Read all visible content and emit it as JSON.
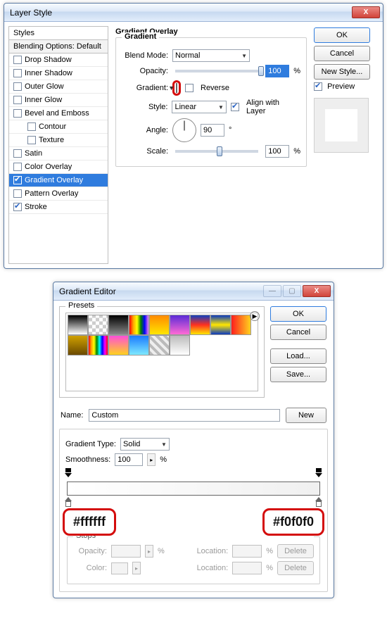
{
  "layerStyle": {
    "title": "Layer Style",
    "stylesHeader": "Styles",
    "blendingOptions": "Blending Options: Default",
    "effects": [
      {
        "label": "Drop Shadow",
        "checked": false,
        "selected": false
      },
      {
        "label": "Inner Shadow",
        "checked": false,
        "selected": false
      },
      {
        "label": "Outer Glow",
        "checked": false,
        "selected": false
      },
      {
        "label": "Inner Glow",
        "checked": false,
        "selected": false
      },
      {
        "label": "Bevel and Emboss",
        "checked": false,
        "selected": false
      },
      {
        "label": "Contour",
        "checked": false,
        "selected": false,
        "indent": true
      },
      {
        "label": "Texture",
        "checked": false,
        "selected": false,
        "indent": true
      },
      {
        "label": "Satin",
        "checked": false,
        "selected": false
      },
      {
        "label": "Color Overlay",
        "checked": false,
        "selected": false
      },
      {
        "label": "Gradient Overlay",
        "checked": true,
        "selected": true
      },
      {
        "label": "Pattern Overlay",
        "checked": false,
        "selected": false
      },
      {
        "label": "Stroke",
        "checked": true,
        "selected": false
      }
    ],
    "panelTitle": "Gradient Overlay",
    "groupTitle": "Gradient",
    "labels": {
      "blendMode": "Blend Mode:",
      "opacity": "Opacity:",
      "gradient": "Gradient:",
      "reverse": "Reverse",
      "style": "Style:",
      "alignWith": "Align with Layer",
      "angle": "Angle:",
      "scale": "Scale:"
    },
    "values": {
      "blendMode": "Normal",
      "opacity": "100",
      "opacityUnit": "%",
      "reverseChecked": false,
      "style": "Linear",
      "alignChecked": true,
      "angle": "90",
      "angleUnit": "°",
      "scale": "100",
      "scaleUnit": "%"
    },
    "buttons": {
      "ok": "OK",
      "cancel": "Cancel",
      "newStyle": "New Style...",
      "previewLabel": "Preview",
      "previewChecked": true
    }
  },
  "gradEditor": {
    "title": "Gradient Editor",
    "presetsLabel": "Presets",
    "buttons": {
      "ok": "OK",
      "cancel": "Cancel",
      "load": "Load...",
      "save": "Save...",
      "new": "New",
      "delete": "Delete"
    },
    "nameLabel": "Name:",
    "nameValue": "Custom",
    "typeLabel": "Gradient Type:",
    "typeValue": "Solid",
    "smoothLabel": "Smoothness:",
    "smoothValue": "100",
    "smoothUnit": "%",
    "stopsHeader": "Stops",
    "opacityLabel": "Opacity:",
    "colorLabel": "Color:",
    "locationLabel": "Location:",
    "percent": "%",
    "leftHex": "#ffffff",
    "rightHex": "#f0f0f0",
    "presets": [
      "linear-gradient(#000,#fff)",
      "repeating-conic-gradient(#ccc 0 25%,#fff 0 50%) 0/10px 10px",
      "linear-gradient(#000,#888)",
      "linear-gradient(90deg,red,orange,yellow,green,blue,violet)",
      "linear-gradient(#ff8a00,#ffe600)",
      "linear-gradient(#5b2bd6,#ff6ad5)",
      "linear-gradient(#1040c0,#ff3020,#ffe600)",
      "linear-gradient(#0a3ac0,#ffe600,#0a3ac0)",
      "linear-gradient(90deg,#ff1e1e,#ffd21e)",
      "linear-gradient(#d0a000,#6b4a00)",
      "linear-gradient(90deg,red,orange,yellow,green,cyan,blue,magenta,red)",
      "linear-gradient(#ff4fd8,#ffd21e)",
      "linear-gradient(#1a7bff,#7ee8ff)",
      "repeating-linear-gradient(45deg,#bbb 0 4px,#eee 4px 8px)",
      "linear-gradient(#bbb,#fff)"
    ]
  }
}
